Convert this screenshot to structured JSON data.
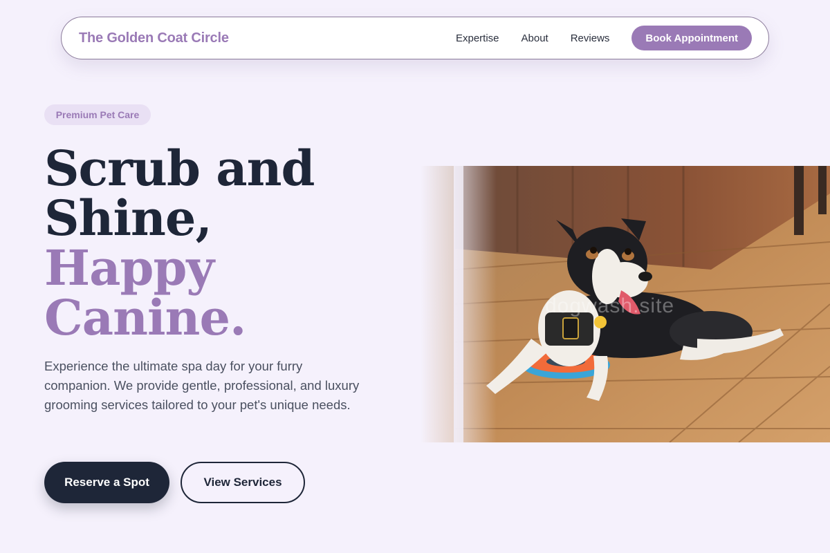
{
  "nav": {
    "brand": "The Golden Coat Circle",
    "links": [
      "Expertise",
      "About",
      "Reviews"
    ],
    "cta": "Book Appointment"
  },
  "hero": {
    "badge": "Premium Pet Care",
    "headline_dark": [
      "Scrub and",
      "Shine,"
    ],
    "headline_accent": [
      "Happy",
      "Canine."
    ],
    "description": "Experience the ultimate spa day for your furry companion. We provide gentle, professional, and luxury grooming services tailored to your pet's unique needs.",
    "primary_button": "Reserve a Spot",
    "secondary_button": "View Services"
  },
  "image": {
    "watermark": "dogwash.site"
  },
  "colors": {
    "background": "#f5f1fc",
    "accent": "#9a7ab6",
    "dark": "#1e2638"
  }
}
